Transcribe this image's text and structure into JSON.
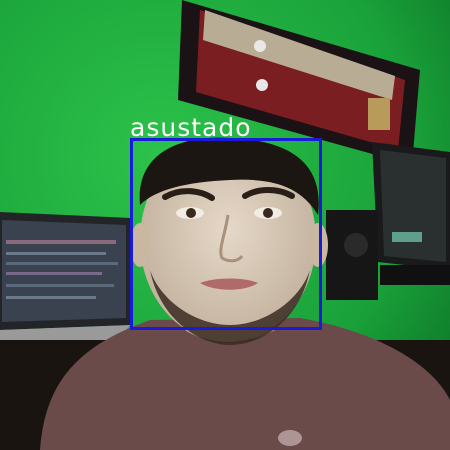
{
  "detection": {
    "label": "asustado",
    "box_color": "#1a1adc",
    "label_color": "#ffffff"
  },
  "scene": {
    "wall_color": "#1ea83e",
    "shirt_color": "#6b4a4a",
    "skin_color": "#d9c9b6",
    "hair_color": "#1c1612"
  }
}
